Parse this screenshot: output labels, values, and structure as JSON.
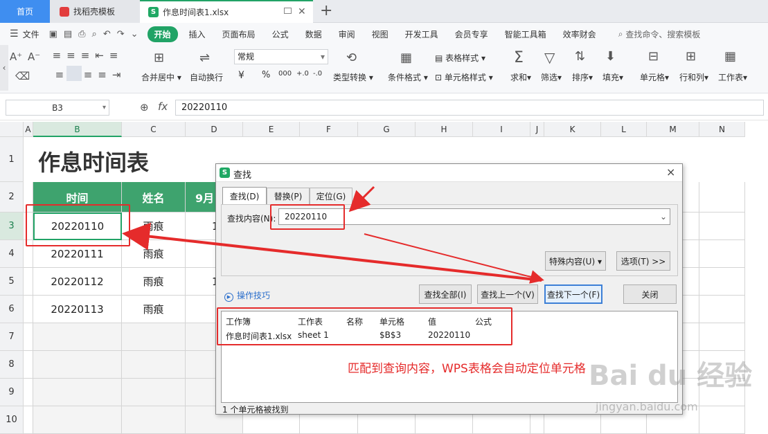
{
  "tabs": {
    "home": "首页",
    "templates": "找稻壳模板",
    "file": "作息时间表1.xlsx",
    "add": "+"
  },
  "menu": {
    "file": "文件",
    "items": [
      "开始",
      "插入",
      "页面布局",
      "公式",
      "数据",
      "审阅",
      "视图",
      "开发工具",
      "会员专享",
      "智能工具箱",
      "效率财会"
    ],
    "search": "查找命令、搜索模板"
  },
  "ribbon": {
    "font_grow": "A⁺",
    "font_shrink": "A⁻",
    "merge": "合并居中",
    "wrap": "自动换行",
    "number_format": "常规",
    "currency": "¥",
    "percent": "%",
    "thousands": "000",
    "dec_add": "+.0",
    "dec_sub": "-.0",
    "convert": "类型转换",
    "cond_format": "条件格式",
    "table_style": "表格样式",
    "cell_style": "单元格样式",
    "sum": "求和",
    "filter": "筛选",
    "sort": "排序",
    "fill": "填充",
    "cell": "单元格",
    "rowcol": "行和列",
    "sheet": "工作表"
  },
  "formula": {
    "namebox": "B3",
    "fx": "fx",
    "value": "20220110"
  },
  "columns": [
    "A",
    "B",
    "C",
    "D",
    "E",
    "F",
    "G",
    "H",
    "I",
    "J",
    "K",
    "L",
    "M",
    "N"
  ],
  "rows": [
    "1",
    "2",
    "3",
    "4",
    "5",
    "6",
    "7",
    "8",
    "9",
    "10"
  ],
  "sheet": {
    "title": "作息时间表",
    "header_time": "时间",
    "header_name": "姓名",
    "header_sep": "9月",
    "dates": [
      "20220110",
      "20220111",
      "20220112",
      "20220113"
    ],
    "names": [
      "雨痕",
      "雨痕",
      "雨痕",
      "雨痕"
    ],
    "d_vals": [
      "1",
      "",
      "1",
      ""
    ]
  },
  "dialog": {
    "title": "查找",
    "close": "×",
    "tabs": [
      "查找(D)",
      "替换(P)",
      "定位(G)"
    ],
    "find_label": "查找内容(N):",
    "find_value": "20220110",
    "special": "特殊内容(U) ▾",
    "options": "选项(T) >>",
    "tips": "操作技巧",
    "find_all": "查找全部(I)",
    "find_prev": "查找上一个(V)",
    "find_next": "查找下一个(F)",
    "close_btn": "关闭",
    "result_headers": [
      "工作簿",
      "工作表",
      "名称",
      "单元格",
      "值",
      "公式"
    ],
    "result_row": [
      "作息时间表1.xlsx",
      "sheet 1",
      "",
      "$B$3",
      "20220110",
      ""
    ],
    "status": "1 个单元格被找到"
  },
  "annotation": "匹配到查询内容，WPS表格会自动定位单元格",
  "watermark": {
    "brand": "Bai du 经验",
    "url": "jingyan.baidu.com"
  },
  "colors": {
    "green": "#21a366",
    "header_fill": "#3ea36e",
    "red": "#e52b2b",
    "blue_tab": "#3f8ef0"
  }
}
